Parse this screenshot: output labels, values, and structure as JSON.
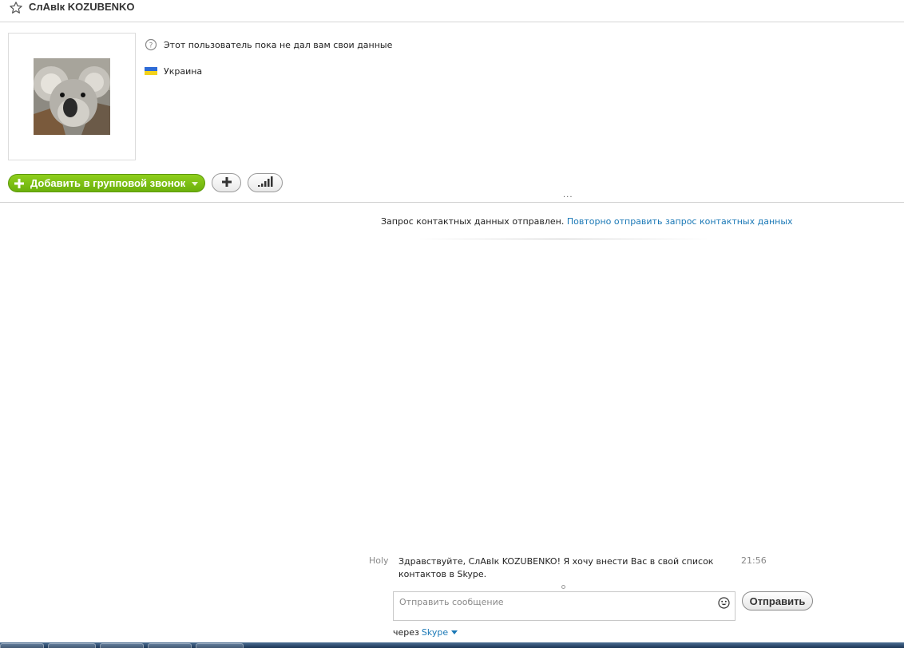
{
  "header": {
    "title": "СлАвІк KOZUBENKO",
    "favorite_icon": "star-outline-icon"
  },
  "profile": {
    "avatar": "koala-avatar",
    "status_text": "Этот пользователь пока не дал вам свои данные",
    "status_icon": "skype-unknown-status-icon",
    "country": "Украина",
    "country_icon": "ukraine-flag-icon"
  },
  "actions": {
    "call_button_label": "Добавить в групповой звонок",
    "add_icon": "plus-icon",
    "signal_icon": "signal-bars-icon",
    "brand_green": "#7ac013"
  },
  "notice": {
    "text": "Запрос контактных данных отправлен.",
    "link_text": "Повторно отправить запрос контактных данных",
    "link_color": "#1a78b6"
  },
  "message": {
    "sender": "Holy",
    "text": "Здравствуйте, СлАвІк KOZUBENKO! Я хочу внести Вас в свой список контактов в Skype.",
    "time": "21:56"
  },
  "compose": {
    "placeholder": "Отправить сообщение",
    "value": "",
    "emoji_icon": "smiley-icon",
    "send_label": "Отправить",
    "via_label": "через",
    "via_link": "Skype"
  }
}
